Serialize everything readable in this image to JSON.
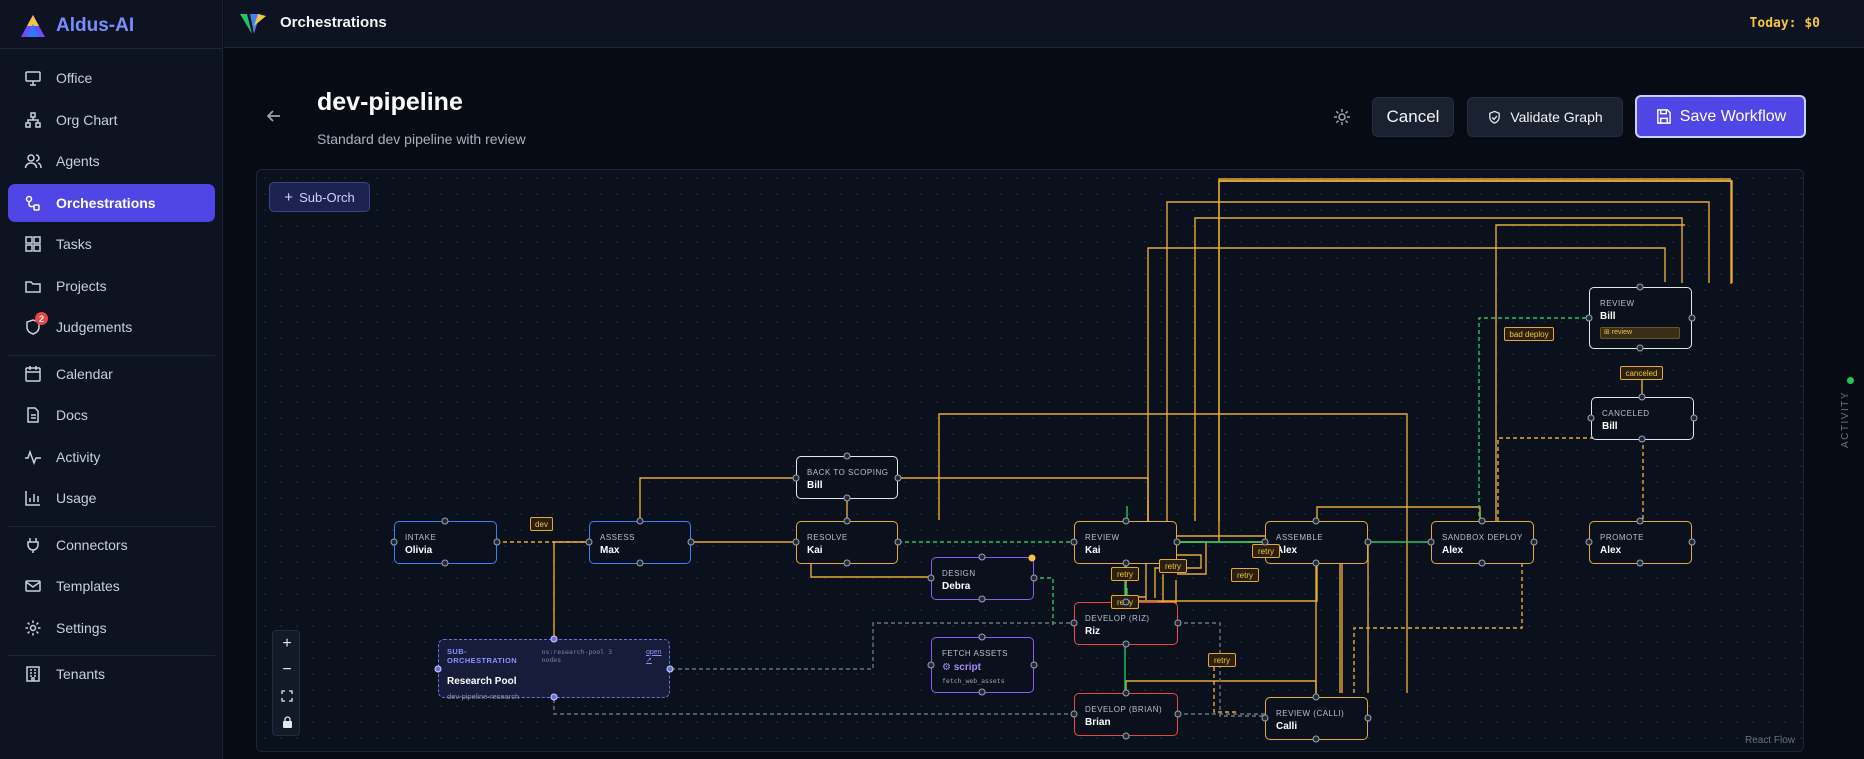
{
  "app": {
    "brand": "Aldus-AI",
    "section_title": "Orchestrations",
    "spend": "Today: $0"
  },
  "sidebar": {
    "items": [
      {
        "label": "Office",
        "icon": "monitor-icon"
      },
      {
        "label": "Org Chart",
        "icon": "org-chart-icon"
      },
      {
        "label": "Agents",
        "icon": "users-icon"
      },
      {
        "label": "Orchestrations",
        "icon": "workflow-icon",
        "active": true
      },
      {
        "label": "Tasks",
        "icon": "tasks-icon"
      },
      {
        "label": "Projects",
        "icon": "folder-icon"
      },
      {
        "label": "Judgements",
        "icon": "shield-icon",
        "badge": "2"
      },
      {
        "label": "Calendar",
        "icon": "calendar-icon"
      },
      {
        "label": "Docs",
        "icon": "doc-icon"
      },
      {
        "label": "Activity",
        "icon": "activity-icon"
      },
      {
        "label": "Usage",
        "icon": "bar-chart-icon"
      },
      {
        "label": "Connectors",
        "icon": "plug-icon"
      },
      {
        "label": "Templates",
        "icon": "mail-icon"
      },
      {
        "label": "Settings",
        "icon": "gear-icon"
      },
      {
        "label": "Tenants",
        "icon": "building-icon"
      }
    ]
  },
  "header": {
    "title": "dev-pipeline",
    "subtitle": "Standard dev pipeline with review",
    "cancel_label": "Cancel",
    "validate_label": "Validate Graph",
    "save_label": "Save Workflow"
  },
  "canvas": {
    "suborch_button": "Sub-Orch",
    "attribution": "React Flow",
    "activity_label": "ACTIVITY",
    "nodes": [
      {
        "id": "intake",
        "type": "INTAKE",
        "agent": "Olivia",
        "color": "blue"
      },
      {
        "id": "assess",
        "type": "ASSESS",
        "agent": "Max",
        "color": "blue"
      },
      {
        "id": "back_to_scoping",
        "type": "BACK TO SCOPING",
        "agent": "Bill",
        "color": "white"
      },
      {
        "id": "resolve",
        "type": "RESOLVE",
        "agent": "Kai",
        "color": "yellow"
      },
      {
        "id": "design",
        "type": "DESIGN",
        "agent": "Debra",
        "color": "purple"
      },
      {
        "id": "review_kai",
        "type": "REVIEW",
        "agent": "Kai",
        "color": "yellow"
      },
      {
        "id": "develop_riz",
        "type": "DEVELOP (RIZ)",
        "agent": "Riz",
        "color": "red"
      },
      {
        "id": "fetch_assets",
        "type": "FETCH ASSETS",
        "script_label": "⚙ script",
        "script_fn": "fetch_web_assets",
        "color": "purple"
      },
      {
        "id": "develop_brian",
        "type": "DEVELOP (BRIAN)",
        "agent": "Brian",
        "color": "red"
      },
      {
        "id": "assemble",
        "type": "ASSEMBLE",
        "agent": "Alex",
        "color": "yellow"
      },
      {
        "id": "review_calli",
        "type": "REVIEW (CALLI)",
        "agent": "Calli",
        "color": "yellow"
      },
      {
        "id": "sandbox_deploy",
        "type": "SANDBOX DEPLOY",
        "agent": "Alex",
        "color": "yellow"
      },
      {
        "id": "review_bill",
        "type": "REVIEW",
        "agent": "Bill",
        "chip": "⊞ review",
        "color": "white"
      },
      {
        "id": "canceled",
        "type": "CANCELED",
        "agent": "Bill",
        "color": "white"
      },
      {
        "id": "promote",
        "type": "PROMOTE",
        "agent": "Alex",
        "color": "yellow"
      }
    ],
    "sub_orchestration": {
      "tag": "SUB-ORCHESTRATION",
      "meta": "ns:research-pool 3 nodes",
      "open_label": "open ↗",
      "name": "Research Pool",
      "workflow": "dev-pipeline-research"
    },
    "edge_labels": {
      "dev": "dev",
      "bad_deploy": "bad deploy",
      "canceled": "canceled",
      "retry": "retry"
    },
    "zoom_controls": [
      "+",
      "−",
      "⛶",
      "🔒"
    ]
  },
  "colors": {
    "accent": "#4f46e5",
    "edge_yellow": "#e4a93a",
    "edge_green": "#22c55e",
    "edge_gray": "#6b7280",
    "danger": "#ef4444"
  }
}
